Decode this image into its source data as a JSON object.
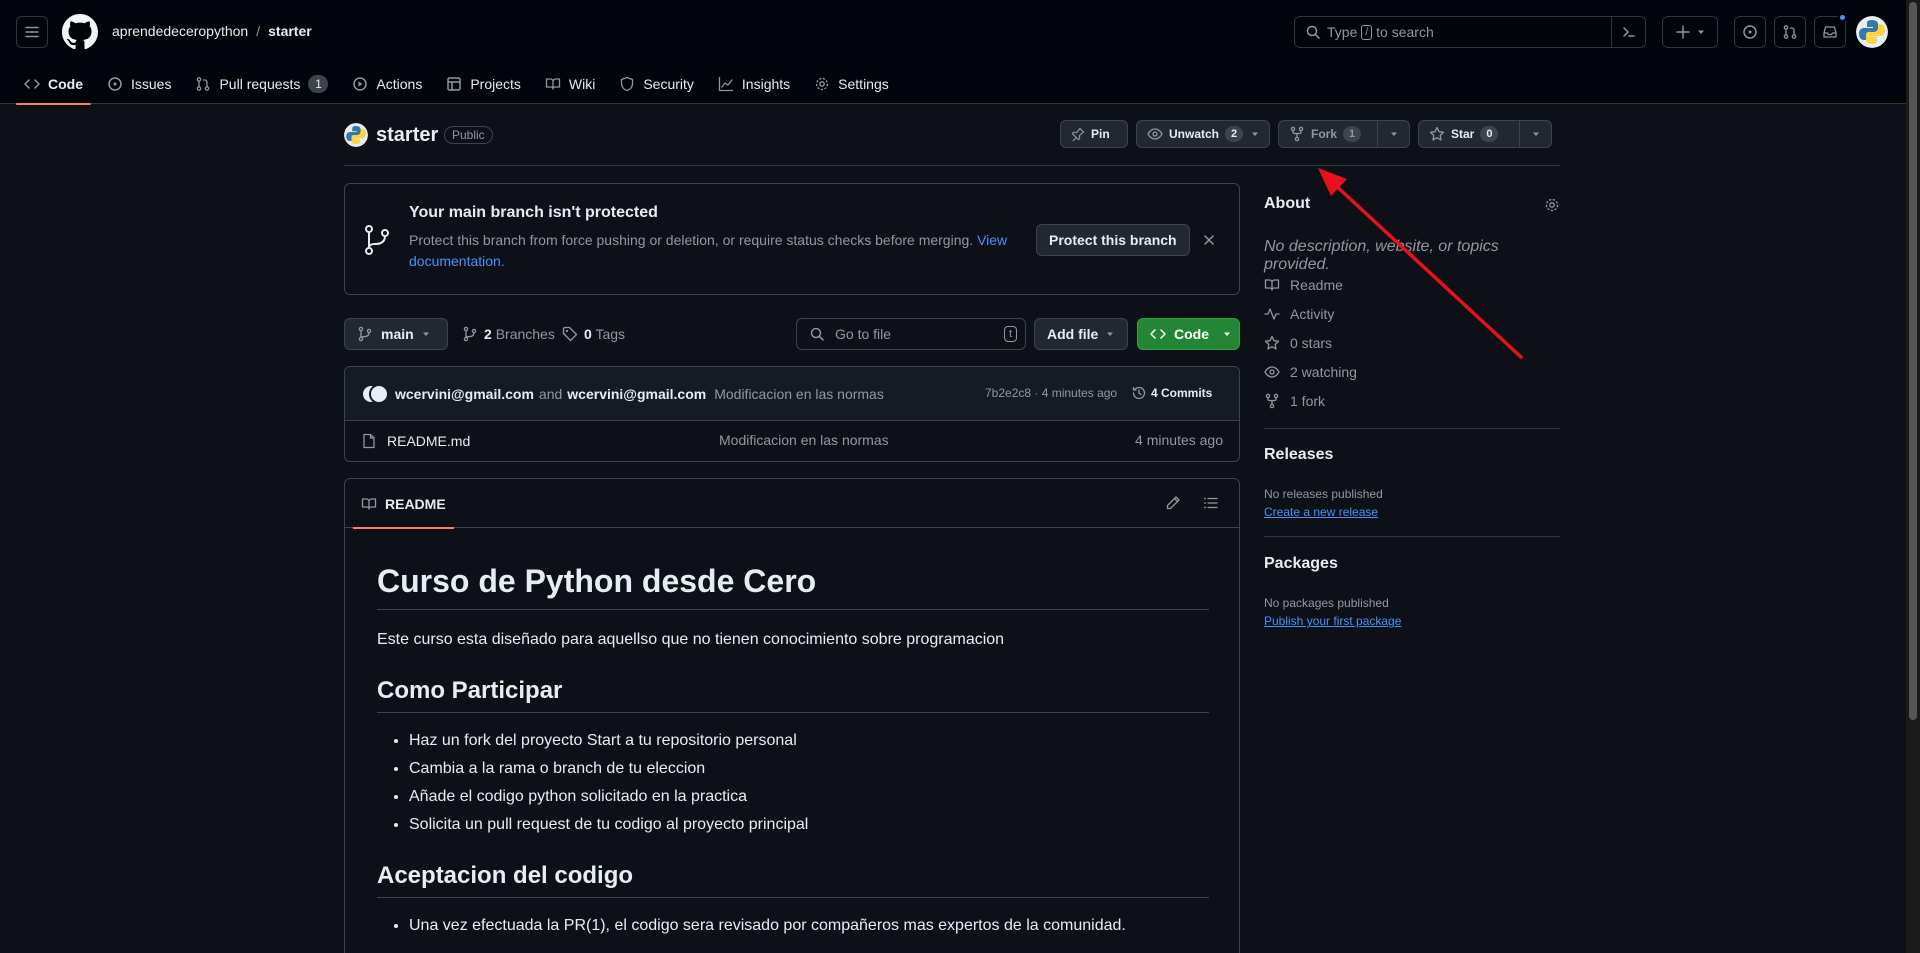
{
  "header": {
    "owner": "aprendedeceropython",
    "separator": "/",
    "repo": "starter",
    "search_pre": "Type",
    "search_key": "/",
    "search_post": "to search"
  },
  "tabs": [
    {
      "label": "Code",
      "icon": "code-icon",
      "selected": true
    },
    {
      "label": "Issues",
      "icon": "issue-icon"
    },
    {
      "label": "Pull requests",
      "icon": "pull-request-icon",
      "count": "1"
    },
    {
      "label": "Actions",
      "icon": "play-icon"
    },
    {
      "label": "Projects",
      "icon": "table-icon"
    },
    {
      "label": "Wiki",
      "icon": "book-icon"
    },
    {
      "label": "Security",
      "icon": "shield-icon"
    },
    {
      "label": "Insights",
      "icon": "graph-icon"
    },
    {
      "label": "Settings",
      "icon": "gear-icon"
    }
  ],
  "repo": {
    "title": "starter",
    "visibility": "Public",
    "pin": "Pin",
    "watch": "Unwatch",
    "watch_count": "2",
    "fork": "Fork",
    "fork_count": "1",
    "star": "Star",
    "star_count": "0"
  },
  "protect": {
    "title": "Your main branch isn't protected",
    "desc": "Protect this branch from force pushing or deletion, or require status checks before merging.",
    "link": "View documentation.",
    "button": "Protect this branch"
  },
  "filenav": {
    "branch": "main",
    "branches_count": "2",
    "branches_label": "Branches",
    "tags_count": "0",
    "tags_label": "Tags",
    "gofile_placeholder": "Go to file",
    "gofile_key": "t",
    "add_file": "Add file",
    "code": "Code"
  },
  "commit": {
    "author1": "wcervini@gmail.com",
    "and": "and",
    "author2": "wcervini@gmail.com",
    "message": "Modificacion en las normas",
    "sha_time": "7b2e2c8 · 4 minutes ago",
    "commits": "4 Commits"
  },
  "files": [
    {
      "name": "README.md",
      "message": "Modificacion en las normas",
      "age": "4 minutes ago"
    }
  ],
  "readme": {
    "tab": "README",
    "h1": "Curso de Python desde Cero",
    "intro": "Este curso esta diseñado para aquellso que no tienen conocimiento sobre programacion",
    "h2_1": "Como Participar",
    "steps": [
      "Haz un fork del proyecto Start a tu repositorio personal",
      "Cambia a la rama o branch de tu eleccion",
      "Añade el codigo python solicitado en la practica",
      "Solicita un pull request de tu codigo al proyecto principal"
    ],
    "h2_2": "Aceptacion del codigo",
    "accept": [
      "Una vez efectuada la PR(1), el codigo sera revisado por compañeros mas expertos de la comunidad."
    ]
  },
  "sidebar": {
    "about_title": "About",
    "about_desc": "No description, website, or topics provided.",
    "items": [
      {
        "label": "Readme",
        "icon": "book-icon"
      },
      {
        "label": "Activity",
        "icon": "pulse-icon"
      },
      {
        "label": "0 stars",
        "icon": "star-icon"
      },
      {
        "label": "2 watching",
        "icon": "eye-icon"
      },
      {
        "label": "1 fork",
        "icon": "fork-icon"
      }
    ],
    "releases_title": "Releases",
    "releases_none": "No releases published",
    "releases_link": "Create a new release",
    "packages_title": "Packages",
    "packages_none": "No packages published",
    "packages_link": "Publish your first package"
  },
  "colors": {
    "accent_tab": "#f78166",
    "code_button": "#238636",
    "link": "#4493f8",
    "annotation_arrow": "#e8101a"
  }
}
